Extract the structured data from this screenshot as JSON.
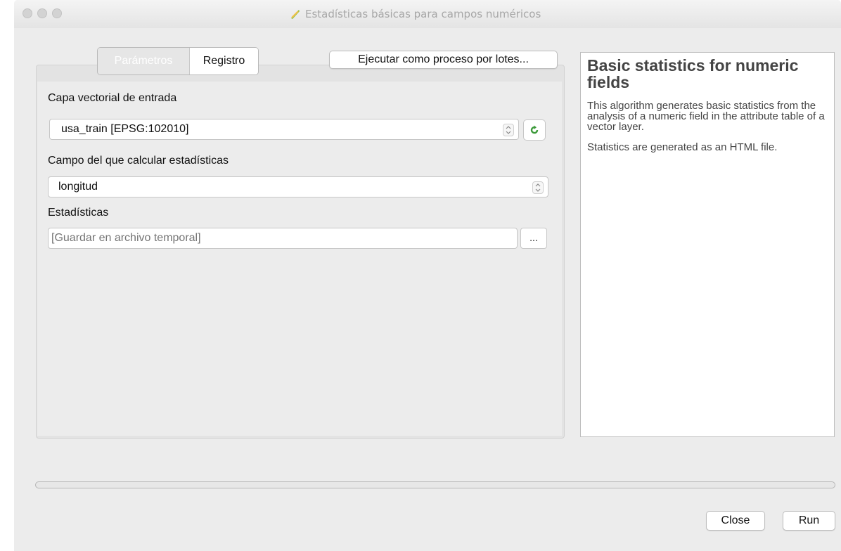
{
  "window": {
    "title": "Estadísticas básicas para campos numéricos"
  },
  "tabs": [
    {
      "label": "Parámetros",
      "active": false
    },
    {
      "label": "Registro",
      "active": true
    }
  ],
  "toolbar": {
    "batch_label": "Ejecutar como proceso por lotes..."
  },
  "params": {
    "input_layer_label": "Capa vectorial de entrada",
    "input_layer_value": "usa_train [EPSG:102010]",
    "field_label": "Campo del que calcular estadísticas",
    "field_value": "longitud",
    "output_label": "Estadísticas",
    "output_placeholder": "[Guardar en archivo temporal]",
    "browse_label": "..."
  },
  "help": {
    "title": "Basic statistics for numeric fields",
    "paragraph1": "This algorithm generates basic statistics from the analysis of a numeric field in the attribute table of a vector layer.",
    "paragraph2": "Statistics are generated as an HTML file."
  },
  "progress": {
    "value": 0
  },
  "buttons": {
    "close_label": "Close",
    "run_label": "Run"
  },
  "colors": {
    "window_bg": "#ececec",
    "refresh_icon": "#3c9a3a"
  }
}
